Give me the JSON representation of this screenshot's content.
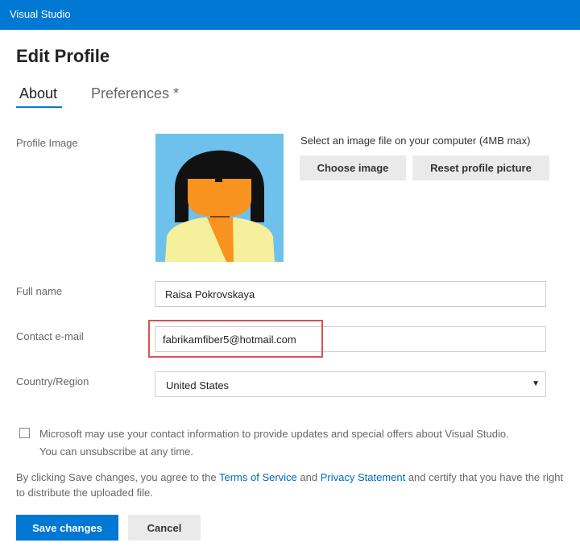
{
  "app": {
    "title": "Visual Studio"
  },
  "page": {
    "title": "Edit Profile"
  },
  "tabs": [
    {
      "label": "About",
      "active": true
    },
    {
      "label": "Preferences *",
      "active": false
    }
  ],
  "profile_image": {
    "label": "Profile Image",
    "hint": "Select an image file on your computer (4MB max)",
    "choose_label": "Choose image",
    "reset_label": "Reset profile picture"
  },
  "full_name": {
    "label": "Full name",
    "value": "Raisa Pokrovskaya"
  },
  "contact_email": {
    "label": "Contact e-mail",
    "value": "fabrikamfiber5@hotmail.com"
  },
  "country": {
    "label": "Country/Region",
    "value": "United States"
  },
  "consent": {
    "checked": false,
    "line1": "Microsoft may use your contact information to provide updates and special offers about Visual Studio.",
    "line2": "You can unsubscribe at any time."
  },
  "legal": {
    "prefix": "By clicking Save changes, you agree to the ",
    "terms_link": "Terms of Service",
    "and": " and ",
    "privacy_link": "Privacy Statement",
    "suffix": " and certify that you have the right to distribute the uploaded file."
  },
  "actions": {
    "save_label": "Save changes",
    "cancel_label": "Cancel"
  },
  "colors": {
    "brand": "#0078d4",
    "highlight": "#d9534f",
    "link": "#0067b8"
  }
}
